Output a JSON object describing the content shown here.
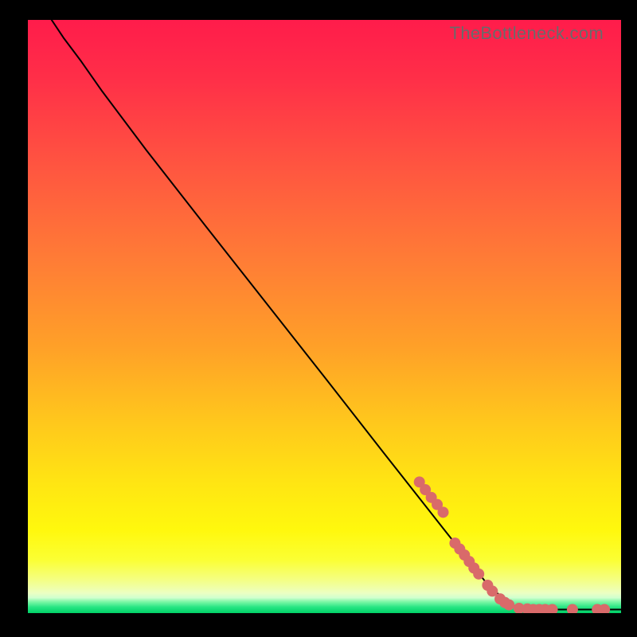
{
  "watermark": "TheBottleneck.com",
  "chart_data": {
    "type": "line",
    "title": "",
    "xlabel": "",
    "ylabel": "",
    "xlim": [
      0,
      100
    ],
    "ylim": [
      0,
      100
    ],
    "curve": {
      "name": "primary-curve",
      "color": "#000000",
      "points": [
        {
          "x": 4.0,
          "y": 100.0
        },
        {
          "x": 6.0,
          "y": 97.0
        },
        {
          "x": 9.0,
          "y": 93.0
        },
        {
          "x": 12.5,
          "y": 88.0
        },
        {
          "x": 20.0,
          "y": 78.0
        },
        {
          "x": 30.0,
          "y": 65.2
        },
        {
          "x": 40.0,
          "y": 52.5
        },
        {
          "x": 50.0,
          "y": 39.8
        },
        {
          "x": 60.0,
          "y": 27.0
        },
        {
          "x": 70.0,
          "y": 14.3
        },
        {
          "x": 78.0,
          "y": 4.2
        },
        {
          "x": 82.0,
          "y": 1.2
        },
        {
          "x": 85.0,
          "y": 0.6
        },
        {
          "x": 100.0,
          "y": 0.6
        }
      ]
    },
    "scatter": {
      "name": "highlight-points",
      "color": "#d96a6a",
      "radius": 7,
      "points": [
        {
          "x": 66.0,
          "y": 22.1
        },
        {
          "x": 67.0,
          "y": 20.8
        },
        {
          "x": 68.0,
          "y": 19.5
        },
        {
          "x": 69.0,
          "y": 18.3
        },
        {
          "x": 70.0,
          "y": 17.0
        },
        {
          "x": 72.0,
          "y": 11.8
        },
        {
          "x": 72.8,
          "y": 10.8
        },
        {
          "x": 73.6,
          "y": 9.8
        },
        {
          "x": 74.4,
          "y": 8.7
        },
        {
          "x": 75.2,
          "y": 7.6
        },
        {
          "x": 76.0,
          "y": 6.6
        },
        {
          "x": 77.5,
          "y": 4.7
        },
        {
          "x": 78.3,
          "y": 3.7
        },
        {
          "x": 79.6,
          "y": 2.4
        },
        {
          "x": 80.4,
          "y": 1.8
        },
        {
          "x": 81.1,
          "y": 1.4
        },
        {
          "x": 82.8,
          "y": 0.8
        },
        {
          "x": 84.2,
          "y": 0.7
        },
        {
          "x": 85.2,
          "y": 0.6
        },
        {
          "x": 86.2,
          "y": 0.6
        },
        {
          "x": 87.2,
          "y": 0.6
        },
        {
          "x": 88.4,
          "y": 0.6
        },
        {
          "x": 91.8,
          "y": 0.6
        },
        {
          "x": 96.0,
          "y": 0.6
        },
        {
          "x": 97.2,
          "y": 0.6
        }
      ]
    }
  }
}
